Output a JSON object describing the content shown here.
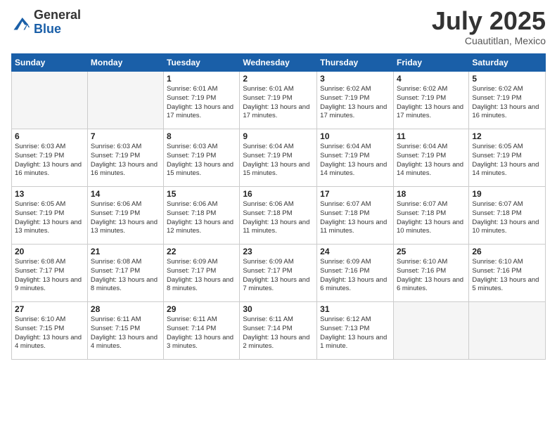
{
  "logo": {
    "general": "General",
    "blue": "Blue"
  },
  "title": {
    "month": "July 2025",
    "location": "Cuautitlan, Mexico"
  },
  "weekdays": [
    "Sunday",
    "Monday",
    "Tuesday",
    "Wednesday",
    "Thursday",
    "Friday",
    "Saturday"
  ],
  "weeks": [
    [
      {
        "day": "",
        "info": ""
      },
      {
        "day": "",
        "info": ""
      },
      {
        "day": "1",
        "info": "Sunrise: 6:01 AM\nSunset: 7:19 PM\nDaylight: 13 hours and 17 minutes."
      },
      {
        "day": "2",
        "info": "Sunrise: 6:01 AM\nSunset: 7:19 PM\nDaylight: 13 hours and 17 minutes."
      },
      {
        "day": "3",
        "info": "Sunrise: 6:02 AM\nSunset: 7:19 PM\nDaylight: 13 hours and 17 minutes."
      },
      {
        "day": "4",
        "info": "Sunrise: 6:02 AM\nSunset: 7:19 PM\nDaylight: 13 hours and 17 minutes."
      },
      {
        "day": "5",
        "info": "Sunrise: 6:02 AM\nSunset: 7:19 PM\nDaylight: 13 hours and 16 minutes."
      }
    ],
    [
      {
        "day": "6",
        "info": "Sunrise: 6:03 AM\nSunset: 7:19 PM\nDaylight: 13 hours and 16 minutes."
      },
      {
        "day": "7",
        "info": "Sunrise: 6:03 AM\nSunset: 7:19 PM\nDaylight: 13 hours and 16 minutes."
      },
      {
        "day": "8",
        "info": "Sunrise: 6:03 AM\nSunset: 7:19 PM\nDaylight: 13 hours and 15 minutes."
      },
      {
        "day": "9",
        "info": "Sunrise: 6:04 AM\nSunset: 7:19 PM\nDaylight: 13 hours and 15 minutes."
      },
      {
        "day": "10",
        "info": "Sunrise: 6:04 AM\nSunset: 7:19 PM\nDaylight: 13 hours and 14 minutes."
      },
      {
        "day": "11",
        "info": "Sunrise: 6:04 AM\nSunset: 7:19 PM\nDaylight: 13 hours and 14 minutes."
      },
      {
        "day": "12",
        "info": "Sunrise: 6:05 AM\nSunset: 7:19 PM\nDaylight: 13 hours and 14 minutes."
      }
    ],
    [
      {
        "day": "13",
        "info": "Sunrise: 6:05 AM\nSunset: 7:19 PM\nDaylight: 13 hours and 13 minutes."
      },
      {
        "day": "14",
        "info": "Sunrise: 6:06 AM\nSunset: 7:19 PM\nDaylight: 13 hours and 13 minutes."
      },
      {
        "day": "15",
        "info": "Sunrise: 6:06 AM\nSunset: 7:18 PM\nDaylight: 13 hours and 12 minutes."
      },
      {
        "day": "16",
        "info": "Sunrise: 6:06 AM\nSunset: 7:18 PM\nDaylight: 13 hours and 11 minutes."
      },
      {
        "day": "17",
        "info": "Sunrise: 6:07 AM\nSunset: 7:18 PM\nDaylight: 13 hours and 11 minutes."
      },
      {
        "day": "18",
        "info": "Sunrise: 6:07 AM\nSunset: 7:18 PM\nDaylight: 13 hours and 10 minutes."
      },
      {
        "day": "19",
        "info": "Sunrise: 6:07 AM\nSunset: 7:18 PM\nDaylight: 13 hours and 10 minutes."
      }
    ],
    [
      {
        "day": "20",
        "info": "Sunrise: 6:08 AM\nSunset: 7:17 PM\nDaylight: 13 hours and 9 minutes."
      },
      {
        "day": "21",
        "info": "Sunrise: 6:08 AM\nSunset: 7:17 PM\nDaylight: 13 hours and 8 minutes."
      },
      {
        "day": "22",
        "info": "Sunrise: 6:09 AM\nSunset: 7:17 PM\nDaylight: 13 hours and 8 minutes."
      },
      {
        "day": "23",
        "info": "Sunrise: 6:09 AM\nSunset: 7:17 PM\nDaylight: 13 hours and 7 minutes."
      },
      {
        "day": "24",
        "info": "Sunrise: 6:09 AM\nSunset: 7:16 PM\nDaylight: 13 hours and 6 minutes."
      },
      {
        "day": "25",
        "info": "Sunrise: 6:10 AM\nSunset: 7:16 PM\nDaylight: 13 hours and 6 minutes."
      },
      {
        "day": "26",
        "info": "Sunrise: 6:10 AM\nSunset: 7:16 PM\nDaylight: 13 hours and 5 minutes."
      }
    ],
    [
      {
        "day": "27",
        "info": "Sunrise: 6:10 AM\nSunset: 7:15 PM\nDaylight: 13 hours and 4 minutes."
      },
      {
        "day": "28",
        "info": "Sunrise: 6:11 AM\nSunset: 7:15 PM\nDaylight: 13 hours and 4 minutes."
      },
      {
        "day": "29",
        "info": "Sunrise: 6:11 AM\nSunset: 7:14 PM\nDaylight: 13 hours and 3 minutes."
      },
      {
        "day": "30",
        "info": "Sunrise: 6:11 AM\nSunset: 7:14 PM\nDaylight: 13 hours and 2 minutes."
      },
      {
        "day": "31",
        "info": "Sunrise: 6:12 AM\nSunset: 7:13 PM\nDaylight: 13 hours and 1 minute."
      },
      {
        "day": "",
        "info": ""
      },
      {
        "day": "",
        "info": ""
      }
    ]
  ]
}
